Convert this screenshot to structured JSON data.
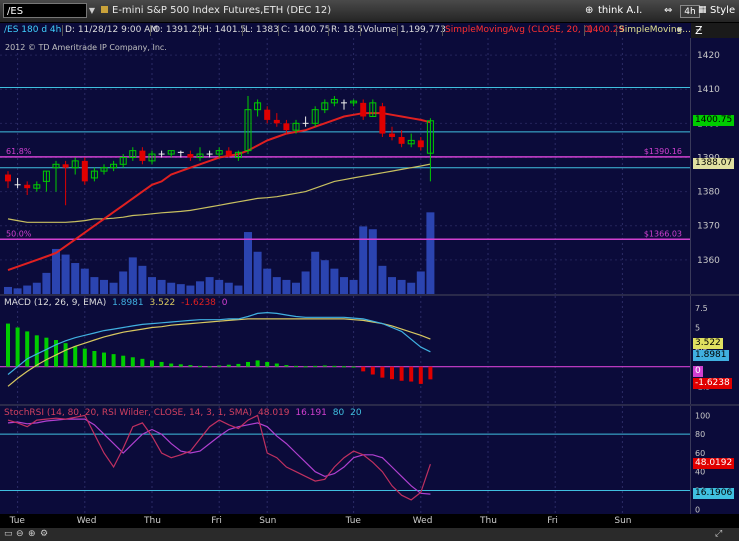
{
  "header": {
    "symbol": "/ES",
    "description": "E-mini S&P 500 Index Futures,ETH (DEC 12)",
    "think_ai": "think A.I.",
    "timeframe": "4h",
    "style": "Style"
  },
  "info_bar": {
    "symbol_period": "/ES 180 d 4h",
    "date": "D: 11/28/12 9:00 AM",
    "open": "O: 1391.25",
    "high": "H: 1401.5",
    "low": "L: 1383",
    "close": "C: 1400.75",
    "range": "R: 18.5",
    "volume_label": "Volume",
    "volume_value": "1,199,773",
    "sma_label": "SimpleMovingAvg (CLOSE, 20, 0)",
    "sma_value": "1400.29",
    "sma2_label": "SimpleMoving..."
  },
  "copyright": "2012 © TD Ameritrade IP Company, Inc.",
  "colors": {
    "background": "#0b0b3a",
    "up_candle": "#00cc00",
    "down_candle": "#e00000",
    "neutral_candle": "#f0f0f0",
    "volume": "#2b44b0",
    "sma20": "#e02020",
    "sma_slow": "#c8c060",
    "horizontal_level": "#40c0e0",
    "fib_level": "#d040d0",
    "macd_value": "#40b0e0",
    "macd_avg": "#d8c860",
    "stoch_k": "#c03060",
    "stoch_d": "#b040d0"
  },
  "chart_data": [
    {
      "type": "candlestick",
      "name": "price",
      "x_labels": [
        "Tue",
        "Wed",
        "Thu",
        "Fri",
        "Sun",
        "Tue",
        "Wed",
        "Thu",
        "Fri",
        "Sun"
      ],
      "ylim": [
        1350,
        1425
      ],
      "y_ticks": [
        1360,
        1370,
        1380,
        1390,
        1400,
        1410,
        1420
      ],
      "candles": [
        {
          "o": 1385,
          "h": 1386,
          "l": 1381,
          "c": 1383
        },
        {
          "o": 1382,
          "h": 1384,
          "l": 1381,
          "c": 1382
        },
        {
          "o": 1382,
          "h": 1383,
          "l": 1379,
          "c": 1381
        },
        {
          "o": 1381,
          "h": 1383,
          "l": 1380,
          "c": 1382
        },
        {
          "o": 1383,
          "h": 1386,
          "l": 1380,
          "c": 1386
        },
        {
          "o": 1387,
          "h": 1389,
          "l": 1380,
          "c": 1388
        },
        {
          "o": 1388,
          "h": 1389,
          "l": 1376,
          "c": 1387
        },
        {
          "o": 1387,
          "h": 1390,
          "l": 1385,
          "c": 1389
        },
        {
          "o": 1389,
          "h": 1390,
          "l": 1382,
          "c": 1383
        },
        {
          "o": 1384,
          "h": 1387,
          "l": 1383,
          "c": 1386
        },
        {
          "o": 1386,
          "h": 1388,
          "l": 1385,
          "c": 1387
        },
        {
          "o": 1387,
          "h": 1389,
          "l": 1386,
          "c": 1388
        },
        {
          "o": 1388,
          "h": 1391,
          "l": 1387,
          "c": 1390
        },
        {
          "o": 1390,
          "h": 1393,
          "l": 1389,
          "c": 1392
        },
        {
          "o": 1392,
          "h": 1393,
          "l": 1388,
          "c": 1389
        },
        {
          "o": 1389,
          "h": 1392,
          "l": 1388,
          "c": 1391
        },
        {
          "o": 1391,
          "h": 1392,
          "l": 1390,
          "c": 1391
        },
        {
          "o": 1391,
          "h": 1392,
          "l": 1390,
          "c": 1392
        },
        {
          "o": 1391.5,
          "h": 1392,
          "l": 1390,
          "c": 1391.5
        },
        {
          "o": 1391,
          "h": 1392,
          "l": 1389,
          "c": 1390
        },
        {
          "o": 1390,
          "h": 1393,
          "l": 1389,
          "c": 1391
        },
        {
          "o": 1391,
          "h": 1392,
          "l": 1390,
          "c": 1391
        },
        {
          "o": 1391,
          "h": 1393,
          "l": 1390,
          "c": 1392
        },
        {
          "o": 1392,
          "h": 1393,
          "l": 1390,
          "c": 1390.5
        },
        {
          "o": 1390,
          "h": 1392,
          "l": 1389,
          "c": 1391.5
        },
        {
          "o": 1392,
          "h": 1408,
          "l": 1391,
          "c": 1404
        },
        {
          "o": 1404,
          "h": 1407,
          "l": 1402,
          "c": 1406
        },
        {
          "o": 1404,
          "h": 1405,
          "l": 1400,
          "c": 1401
        },
        {
          "o": 1401,
          "h": 1403,
          "l": 1399,
          "c": 1400
        },
        {
          "o": 1400,
          "h": 1401,
          "l": 1397,
          "c": 1398
        },
        {
          "o": 1398,
          "h": 1401,
          "l": 1397,
          "c": 1400
        },
        {
          "o": 1400,
          "h": 1402,
          "l": 1399,
          "c": 1400
        },
        {
          "o": 1400,
          "h": 1405,
          "l": 1399,
          "c": 1404
        },
        {
          "o": 1404,
          "h": 1407,
          "l": 1403,
          "c": 1406
        },
        {
          "o": 1406,
          "h": 1408,
          "l": 1405,
          "c": 1407
        },
        {
          "o": 1406,
          "h": 1407,
          "l": 1404,
          "c": 1406
        },
        {
          "o": 1406,
          "h": 1407,
          "l": 1405,
          "c": 1406.5
        },
        {
          "o": 1406,
          "h": 1407,
          "l": 1401,
          "c": 1402
        },
        {
          "o": 1402,
          "h": 1407,
          "l": 1402,
          "c": 1406
        },
        {
          "o": 1405,
          "h": 1406,
          "l": 1396,
          "c": 1397
        },
        {
          "o": 1397,
          "h": 1399,
          "l": 1395,
          "c": 1396
        },
        {
          "o": 1396,
          "h": 1398,
          "l": 1393,
          "c": 1394
        },
        {
          "o": 1394,
          "h": 1397,
          "l": 1393,
          "c": 1395
        },
        {
          "o": 1395,
          "h": 1396,
          "l": 1392,
          "c": 1393
        },
        {
          "o": 1391.25,
          "h": 1401.5,
          "l": 1383,
          "c": 1400.75
        }
      ],
      "volume": [
        0.05,
        0.04,
        0.06,
        0.08,
        0.15,
        0.32,
        0.28,
        0.22,
        0.18,
        0.12,
        0.1,
        0.08,
        0.16,
        0.26,
        0.2,
        0.12,
        0.1,
        0.08,
        0.07,
        0.06,
        0.09,
        0.12,
        0.1,
        0.08,
        0.06,
        0.44,
        0.3,
        0.18,
        0.12,
        0.1,
        0.08,
        0.16,
        0.3,
        0.24,
        0.18,
        0.12,
        0.1,
        0.48,
        0.46,
        0.2,
        0.12,
        0.1,
        0.08,
        0.16,
        0.58
      ],
      "sma20": [
        1357,
        1358,
        1359,
        1360,
        1361,
        1362,
        1364,
        1366,
        1368,
        1370,
        1372,
        1374,
        1376,
        1378,
        1380,
        1382,
        1383,
        1385,
        1386,
        1387,
        1388,
        1389,
        1390,
        1390.5,
        1391,
        1392,
        1393.5,
        1395,
        1396,
        1397,
        1397.5,
        1398,
        1399,
        1400,
        1401,
        1402,
        1402.5,
        1403,
        1403,
        1403,
        1402.5,
        1402,
        1401.5,
        1401,
        1400.29
      ],
      "sma_slow": [
        1372,
        1371.5,
        1371,
        1371,
        1371,
        1371,
        1371,
        1371.2,
        1371.5,
        1372,
        1372,
        1372.2,
        1372.5,
        1373,
        1373.2,
        1373.5,
        1373.8,
        1374,
        1374.2,
        1374.5,
        1375,
        1375.5,
        1376,
        1376.5,
        1377,
        1377.5,
        1378,
        1378.2,
        1378.5,
        1379,
        1379.5,
        1380,
        1381,
        1382,
        1383,
        1383.5,
        1384,
        1384.5,
        1385,
        1385.5,
        1386,
        1386.5,
        1387,
        1387.5,
        1388.07
      ],
      "levels": [
        {
          "value": 1410.5,
          "kind": "horizontal"
        },
        {
          "value": 1397.5,
          "kind": "horizontal"
        },
        {
          "value": 1390.16,
          "kind": "fib",
          "label": "61.8%",
          "price_label": "$1390.16"
        },
        {
          "value": 1387,
          "kind": "horizontal"
        },
        {
          "value": 1366.03,
          "kind": "fib",
          "label": "50.0%",
          "price_label": "$1366.03"
        }
      ],
      "tags": [
        {
          "value": 1400.75,
          "text": "1400.75",
          "bg": "#00cc00",
          "fg": "#000000"
        },
        {
          "value": 1388.07,
          "text": "1388.07",
          "bg": "#e0e0a0",
          "fg": "#000000"
        }
      ]
    },
    {
      "type": "macd",
      "name": "MACD",
      "title": "MACD (12, 26, 9, EMA)",
      "value": "1.8981",
      "avg": "3.522",
      "diff": "-1.6238",
      "zero_label": "0",
      "ylim": [
        -4,
        8
      ],
      "y_ticks": [
        -2.5,
        2.5,
        5,
        7.5
      ],
      "histogram": [
        5.5,
        5,
        4.5,
        4,
        3.7,
        3.4,
        3,
        2.6,
        2.3,
        2,
        1.8,
        1.6,
        1.4,
        1.2,
        1,
        0.8,
        0.6,
        0.4,
        0.3,
        0.2,
        0.1,
        0.05,
        0.15,
        0.25,
        0.35,
        0.6,
        0.8,
        0.6,
        0.4,
        0.2,
        0.1,
        0.05,
        0.1,
        0.15,
        0.1,
        0.05,
        0.02,
        -0.6,
        -1,
        -1.4,
        -1.6,
        -1.8,
        -1.9,
        -2.2,
        -1.62
      ],
      "macd": [
        -1,
        0,
        1,
        1.6,
        2.2,
        2.8,
        3.3,
        3.7,
        4,
        4.3,
        4.6,
        4.8,
        5,
        5.2,
        5.4,
        5.5,
        5.6,
        5.7,
        5.8,
        5.9,
        6,
        6,
        6,
        6.1,
        6.1,
        6.4,
        6.8,
        6.9,
        6.8,
        6.6,
        6.4,
        6.3,
        6.3,
        6.3,
        6.3,
        6.3,
        6.2,
        6.1,
        5.8,
        5.5,
        5,
        4.5,
        3.5,
        2.5,
        1.8981
      ],
      "avg_line": [
        -2.5,
        -1.5,
        -0.6,
        0.2,
        0.9,
        1.5,
        2.1,
        2.6,
        3,
        3.4,
        3.8,
        4.1,
        4.4,
        4.6,
        4.8,
        5,
        5.1,
        5.3,
        5.4,
        5.5,
        5.6,
        5.7,
        5.8,
        5.9,
        6,
        6.1,
        6.1,
        6.1,
        6.1,
        6.1,
        6.1,
        6.1,
        6.1,
        6.1,
        6.1,
        6.1,
        6,
        5.9,
        5.7,
        5.5,
        5.2,
        4.8,
        4.4,
        4,
        3.522
      ]
    },
    {
      "type": "line",
      "name": "StochRSI",
      "title": "StochRSI (14, 80, 20, RSI Wilder, CLOSE, 14, 3, 1, SMA)",
      "k_value": "48.019",
      "d_value": "16.191",
      "ob_label": "80",
      "os_label": "20",
      "ylim": [
        -5,
        110
      ],
      "y_ticks": [
        0,
        20,
        40,
        60,
        80,
        100
      ],
      "k": [
        95,
        92,
        88,
        95,
        96,
        97,
        96,
        98,
        100,
        80,
        60,
        45,
        65,
        88,
        92,
        78,
        60,
        55,
        58,
        62,
        75,
        88,
        95,
        90,
        86,
        95,
        100,
        60,
        55,
        45,
        40,
        35,
        30,
        32,
        45,
        55,
        62,
        58,
        50,
        40,
        25,
        15,
        10,
        18,
        48.0192
      ],
      "d": [
        92,
        93,
        91,
        92,
        94,
        95,
        96,
        96,
        96,
        90,
        80,
        70,
        60,
        70,
        80,
        85,
        80,
        70,
        62,
        60,
        62,
        70,
        78,
        85,
        88,
        90,
        92,
        88,
        78,
        70,
        60,
        50,
        40,
        35,
        38,
        45,
        55,
        58,
        58,
        55,
        45,
        35,
        25,
        17,
        16.1906
      ],
      "levels": [
        80,
        20
      ],
      "tags": [
        {
          "value": 48.0192,
          "text": "48.0192",
          "bg": "#e00000",
          "fg": "#ffffff"
        },
        {
          "value": 16.1906,
          "text": "16.1906",
          "bg": "#40c0e0",
          "fg": "#000000"
        }
      ]
    }
  ],
  "x_axis": {
    "labels": [
      {
        "text": "Tue",
        "bar": 1
      },
      {
        "text": "Wed",
        "bar": 8
      },
      {
        "text": "Thu",
        "bar": 15
      },
      {
        "text": "Fri",
        "bar": 22
      },
      {
        "text": "Sun",
        "bar": 27
      },
      {
        "text": "Tue",
        "bar": 36
      },
      {
        "text": "Wed",
        "bar": 43
      },
      {
        "text": "Thu",
        "bar": 50
      },
      {
        "text": "Fri",
        "bar": 57
      },
      {
        "text": "Sun",
        "bar": 64
      }
    ]
  }
}
